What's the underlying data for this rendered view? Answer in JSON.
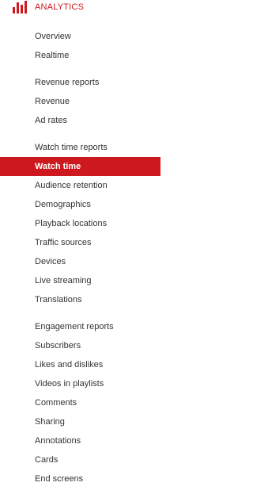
{
  "header": {
    "label": "ANALYTICS",
    "icon": "analytics-bar-chart-icon",
    "accent_color": "#cc181e"
  },
  "sidebar": {
    "top_items": [
      "Overview",
      "Realtime"
    ],
    "revenue": {
      "title": "Revenue reports",
      "items": [
        "Revenue",
        "Ad rates"
      ]
    },
    "watch_time": {
      "title": "Watch time reports",
      "items": [
        "Watch time",
        "Audience retention",
        "Demographics",
        "Playback locations",
        "Traffic sources",
        "Devices",
        "Live streaming",
        "Translations"
      ],
      "active_item": "Watch time"
    },
    "engagement": {
      "title": "Engagement reports",
      "items": [
        "Subscribers",
        "Likes and dislikes",
        "Videos in playlists",
        "Comments",
        "Sharing",
        "Annotations",
        "Cards",
        "End screens"
      ]
    }
  }
}
